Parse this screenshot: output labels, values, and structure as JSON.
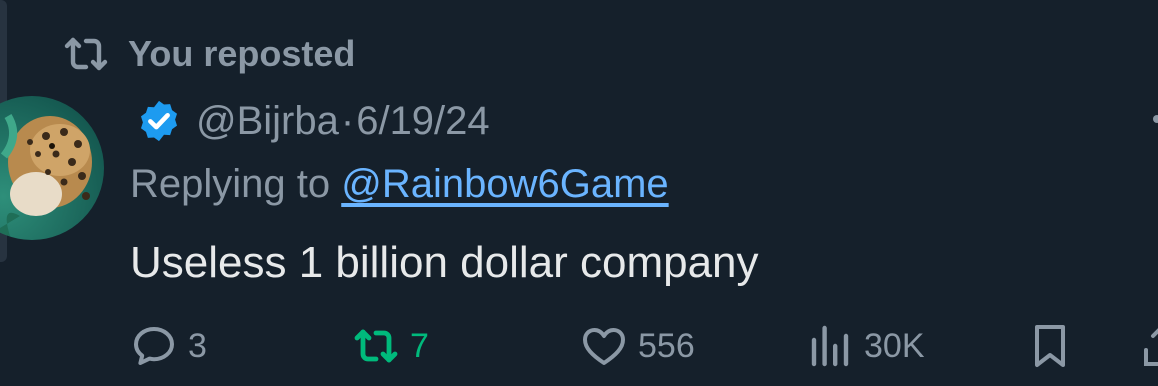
{
  "repost_banner": {
    "label": "You reposted",
    "icon": "repost-icon"
  },
  "author": {
    "handle": "@Bijrba",
    "separator": "·",
    "date": "6/19/24",
    "verified": true,
    "avatar": "jaguar-avatar"
  },
  "reply": {
    "prefix": "Replying to ",
    "to_handle": "@Rainbow6Game"
  },
  "tweet": {
    "text": "Useless 1 billion dollar company"
  },
  "actions": {
    "replies": "3",
    "reposts": "7",
    "likes": "556",
    "views": "30K"
  },
  "colors": {
    "background": "#15202b",
    "muted": "#8b98a5",
    "text": "#e7e9ea",
    "link": "#6ab4ff",
    "repost_active": "#00ba7c",
    "verified": "#1d9bf0"
  }
}
